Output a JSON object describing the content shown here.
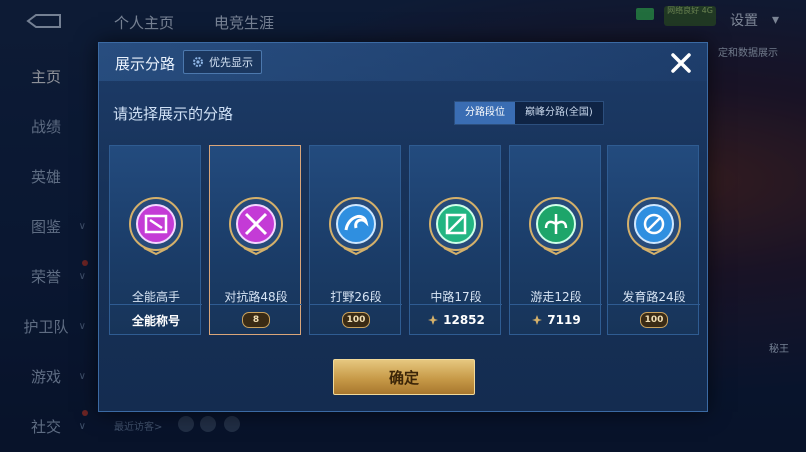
{
  "top": {
    "tabs": [
      "个人主页",
      "电竞生涯"
    ],
    "settings_label": "设置",
    "net_badge": "网络良好 4G",
    "right_partial": "定和数据展示"
  },
  "sidebar": {
    "items": [
      {
        "label": "主页",
        "active": true
      },
      {
        "label": "战绩"
      },
      {
        "label": "英雄"
      },
      {
        "label": "图鉴",
        "chevron": true
      },
      {
        "label": "荣誉",
        "chevron": true,
        "dot": true
      },
      {
        "label": "护卫队",
        "chevron": true
      },
      {
        "label": "游戏",
        "chevron": true
      },
      {
        "label": "社交",
        "chevron": true,
        "dot": true
      }
    ]
  },
  "bottom": {
    "recent_visitors": "最近访客>"
  },
  "hero_button": "秘王",
  "modal": {
    "title": "展示分路",
    "pref_button": "优先显示",
    "subtitle": "请选择展示的分路",
    "segments": [
      {
        "label": "分路段位",
        "active": true
      },
      {
        "label": "巅峰分路(全国)",
        "active": false
      }
    ],
    "cards": [
      {
        "name": "全能高手",
        "footer": "全能称号",
        "color": "#c43bd6",
        "selected": false
      },
      {
        "name": "对抗路48段",
        "footer_level": "8",
        "color": "#c43bd6",
        "selected": true
      },
      {
        "name": "打野26段",
        "footer_level": "100",
        "color": "#2f8fe0",
        "selected": false
      },
      {
        "name": "中路17段",
        "footer": "12852",
        "color": "#22b582",
        "selected": false
      },
      {
        "name": "游走12段",
        "footer": "7119",
        "color": "#1da56a",
        "selected": false
      },
      {
        "name": "发育路24段",
        "footer_level": "100",
        "color": "#2f8fe0",
        "selected": false
      }
    ],
    "confirm": "确定"
  }
}
